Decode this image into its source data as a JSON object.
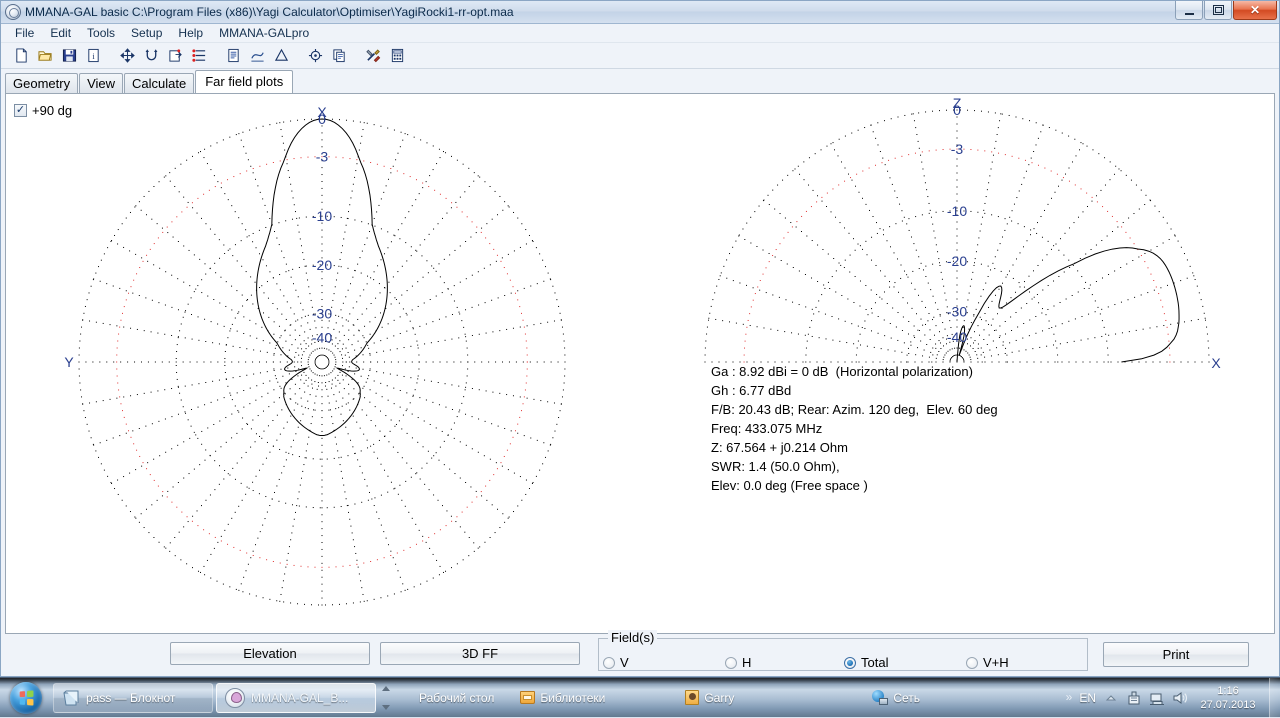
{
  "window": {
    "title": "MMANA-GAL basic C:\\Program Files (x86)\\Yagi Calculator\\Optimiser\\YagiRocki1-rr-opt.maa",
    "app_icon": "mmana-logo-icon",
    "controls": {
      "minimize": "minimize-icon",
      "restore": "restore-icon",
      "close": "✕"
    }
  },
  "menu": {
    "items": [
      "File",
      "Edit",
      "Tools",
      "Setup",
      "Help",
      "MMANA-GALpro"
    ]
  },
  "toolbar": {
    "icons": [
      "new-file-icon",
      "open-folder-icon",
      "save-disk-icon",
      "info-icon",
      "move-arrows-icon",
      "rotate-icon",
      "export-icon",
      "list-settings-icon",
      "document-icon",
      "edit-curve-icon",
      "triangle-icon",
      "target-icon",
      "copy-icon",
      "tools-icon",
      "calculator-icon"
    ]
  },
  "tabs": {
    "items": [
      "Geometry",
      "View",
      "Calculate",
      "Far field plots"
    ],
    "active": "Far field plots"
  },
  "plot": {
    "checkbox_label": "+90 dg",
    "checkbox_checked": true,
    "check_glyph": "✓",
    "info_lines": [
      "Ga : 8.92 dBi = 0 dB  (Horizontal polarization)",
      "Gh : 6.77 dBd",
      "F/B: 20.43 dB; Rear: Azim. 120 deg,  Elev. 60 deg",
      "Freq: 433.075 MHz",
      "Z: 67.564 + j0.214 Ohm",
      "SWR: 1.4 (50.0 Ohm),",
      "Elev: 0.0 deg (Free space )"
    ],
    "ring_color": "#000000",
    "ring_highlight_color": "#e03030",
    "trace_color": "#000000",
    "axis_label_color": "#2a3f8f"
  },
  "chart_data": [
    {
      "type": "line",
      "name": "azimuth-pattern",
      "title": "Azimuth far field plot",
      "coordinate_system": "polar-full",
      "center": [
        320,
        363
      ],
      "outer_radius": 243,
      "axis_labels": {
        "top": "X",
        "left": "Y"
      },
      "ring_labels": [
        "0",
        "-3",
        "-10",
        "-20",
        "-30",
        "-40"
      ],
      "ring_values_db": [
        0,
        -3,
        -10,
        -20,
        -30,
        -40
      ],
      "ring_radius_fraction": [
        1.0,
        0.845,
        0.6,
        0.4,
        0.2,
        0.1
      ],
      "highlight_ring_db": -3,
      "radial_spokes_deg": 10,
      "angle_zero_at": "top",
      "gain_db_by_deg": [
        0,
        -0.03,
        -0.11,
        -0.25,
        -0.45,
        -0.7,
        -1.0,
        -1.35,
        -1.75,
        -2.2,
        -2.7,
        -3.25,
        -3.85,
        -4.5,
        -5.2,
        -5.95,
        -6.7,
        -7.5,
        -8.3,
        -9.1,
        -9.9,
        -10.6,
        -11.3,
        -11.9,
        -12.5,
        -13.0,
        -13.5,
        -13.9,
        -14.3,
        -14.7,
        -15.1,
        -15.5,
        -15.9,
        -16.3,
        -16.7,
        -17.1,
        -17.5,
        -17.9,
        -18.3,
        -18.7,
        -19.1,
        -19.5,
        -19.9,
        -20.3,
        -20.7,
        -21.1,
        -21.5,
        -21.9,
        -22.3,
        -22.7,
        -23.1,
        -23.5,
        -23.9,
        -24.3,
        -24.7,
        -25.1,
        -25.5,
        -25.9,
        -26.3,
        -26.7,
        -27.1,
        -27.5,
        -27.9,
        -28.3,
        -28.7,
        -29.1,
        -29.5,
        -29.9,
        -30.3,
        -30.7,
        -31.1,
        -31.5,
        -31.9,
        -32.3,
        -32.7,
        -33.1,
        -33.5,
        -33.9,
        -34.3,
        -34.7,
        -35.1,
        -35.5,
        -35.9,
        -36.3,
        -36.7,
        -37.1,
        -37.4,
        -37.6,
        -37.7,
        -37.8,
        -37.8,
        -37.7,
        -37.5,
        -37.2,
        -36.8,
        -36.3,
        -35.8,
        -35.3,
        -34.9,
        -34.6,
        -34.4,
        -34.3,
        -34.4,
        -34.6,
        -35.0,
        -35.6,
        -36.4,
        -37.4,
        -38.6,
        -39.8,
        -40.8,
        -41.4,
        -41.6,
        -41.3,
        -40.6,
        -39.6,
        -38.4,
        -37.2,
        -36.0,
        -34.9,
        -33.9,
        -33.1,
        -32.4,
        -31.8,
        -31.3,
        -30.9,
        -30.6,
        -30.3,
        -30.1,
        -29.9,
        -29.7,
        -29.6,
        -29.4,
        -29.3,
        -29.2,
        -29.1,
        -29.0,
        -28.9,
        -28.8,
        -28.7,
        -28.6,
        -28.5,
        -28.4,
        -28.3,
        -28.2,
        -28.1,
        -28.0,
        -27.9,
        -27.8,
        -27.7,
        -27.6,
        -27.5,
        -27.4,
        -27.3,
        -27.2,
        -27.1,
        -27.0,
        -26.9,
        -26.8,
        -26.7,
        -26.6,
        -26.5,
        -26.4,
        -26.3,
        -26.2,
        -26.1,
        -26.0,
        -25.9,
        -25.8,
        -25.7,
        -25.6,
        -25.5,
        -25.4,
        -25.3,
        -25.2,
        -25.1,
        -25.0,
        -24.95,
        -24.9,
        -24.88,
        -24.87
      ]
    },
    {
      "type": "line",
      "name": "elevation-pattern",
      "title": "Elevation far field plot",
      "coordinate_system": "polar-half",
      "center": [
        955,
        363
      ],
      "outer_radius": 252,
      "axis_labels": {
        "top": "Z",
        "right": "X"
      },
      "ring_labels": [
        "0",
        "-3",
        "-10",
        "-20",
        "-30",
        "-40"
      ],
      "ring_values_db": [
        0,
        -3,
        -10,
        -20,
        -30,
        -40
      ],
      "ring_radius_fraction": [
        1.0,
        0.845,
        0.6,
        0.4,
        0.2,
        0.1
      ],
      "highlight_ring_db": -3,
      "radial_spokes_deg": 10,
      "angle_zero_at": "right",
      "gain_db_by_elev_deg": [
        -8.5,
        -6.2,
        -4.8,
        -3.9,
        -3.3,
        -2.9,
        -2.6,
        -2.4,
        -2.25,
        -2.15,
        -2.05,
        -1.98,
        -1.92,
        -1.86,
        -1.81,
        -1.77,
        -1.74,
        -1.71,
        -1.69,
        -1.67,
        -1.66,
        -1.65,
        -1.65,
        -1.66,
        -1.68,
        -1.71,
        -1.76,
        -1.84,
        -1.96,
        -2.12,
        -2.34,
        -2.62,
        -2.98,
        -3.42,
        -3.96,
        -4.6,
        -5.36,
        -6.24,
        -7.26,
        -8.44,
        -9.8,
        -11.3,
        -13.0,
        -14.8,
        -16.7,
        -18.6,
        -20.4,
        -22.1,
        -23.6,
        -24.8,
        -25.7,
        -26.2,
        -26.4,
        -26.2,
        -25.8,
        -25.2,
        -24.5,
        -23.8,
        -23.2,
        -22.8,
        -22.6,
        -22.8,
        -23.3,
        -24.2,
        -25.5,
        -27.2,
        -29.4,
        -32.0,
        -35.0,
        -38.2,
        -41.0,
        -43.0,
        -43.6,
        -42.8,
        -41.2,
        -39.4,
        -37.8,
        -36.6,
        -35.8,
        -35.4,
        -35.4,
        -35.8,
        -36.6,
        -37.8,
        -39.4,
        -41.4,
        -43.6,
        -45.0,
        -45.6,
        -45.2,
        -44.5
      ]
    }
  ],
  "bottom": {
    "elevation_button": "Elevation",
    "threed_button": "3D FF",
    "print_button": "Print",
    "fields_legend": "Field(s)",
    "fields_options": [
      "V",
      "H",
      "Total",
      "V+H"
    ],
    "fields_selected": "Total"
  },
  "taskbar": {
    "start": "windows-start-orb",
    "buttons": [
      {
        "label": "pass — Блокнот",
        "icon": "notepad-icon",
        "active": false
      },
      {
        "label": "MMANA-GAL_B...",
        "icon": "mmana-icon",
        "active": true
      }
    ],
    "toolbar_items": [
      {
        "label": "Рабочий стол",
        "icon": ""
      },
      {
        "label": "Библиотеки",
        "icon": "library-icon"
      },
      {
        "label": "Garry",
        "icon": "user-icon"
      },
      {
        "label": "Сеть",
        "icon": "network-icon"
      }
    ],
    "overflow_glyph": "»",
    "language": "EN",
    "tray_icons": [
      "show-hidden-icon",
      "safely-remove-icon",
      "network-tray-icon",
      "volume-icon"
    ],
    "clock_time": "1:16",
    "clock_date": "27.07.2013"
  }
}
